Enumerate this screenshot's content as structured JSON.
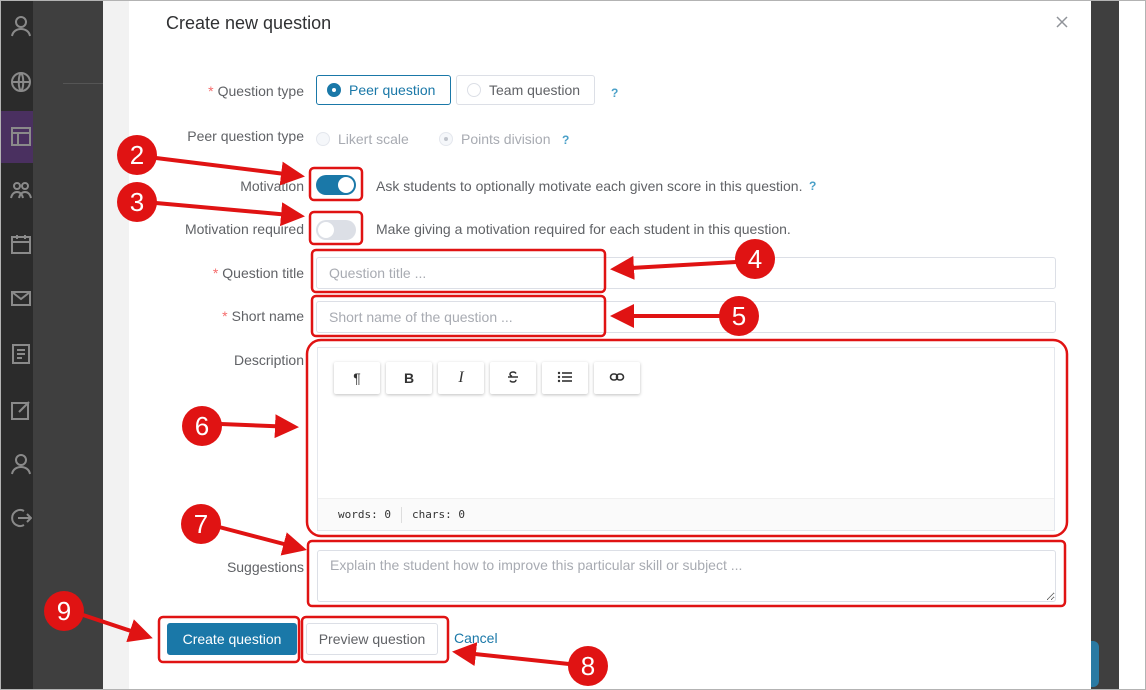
{
  "dialog": {
    "title": "Create new question"
  },
  "form": {
    "question_type": {
      "label": "Question type",
      "options": [
        "Peer question",
        "Team question"
      ],
      "selected": "Peer question"
    },
    "peer_question_type": {
      "label": "Peer question type",
      "options": [
        "Likert scale",
        "Points division"
      ],
      "selected": "Points division"
    },
    "motivation": {
      "label": "Motivation",
      "enabled": true,
      "description": "Ask students to optionally motivate each given score in this question."
    },
    "motivation_required": {
      "label": "Motivation required",
      "enabled": false,
      "description": "Make giving a motivation required for each student in this question."
    },
    "question_title": {
      "label": "Question title",
      "value": "",
      "placeholder": "Question title ..."
    },
    "short_name": {
      "label": "Short name",
      "value": "",
      "placeholder": "Short name of the question ..."
    },
    "description": {
      "label": "Description",
      "toolbar": [
        "paragraph-icon",
        "bold-icon",
        "italic-icon",
        "strikethrough-icon",
        "bullet-list-icon",
        "link-icon"
      ],
      "paragraph_glyph": "¶",
      "bold_glyph": "B",
      "italic_glyph": "I",
      "words_label": "words: 0",
      "chars_label": "chars: 0"
    },
    "suggestions": {
      "label": "Suggestions",
      "value": "",
      "placeholder": "Explain the student how to improve this particular skill or subject ..."
    }
  },
  "actions": {
    "create": "Create question",
    "preview": "Preview question",
    "cancel": "Cancel"
  },
  "help_glyph": "?",
  "annotations": [
    "2",
    "3",
    "4",
    "5",
    "6",
    "7",
    "8",
    "9"
  ],
  "colors": {
    "primary": "#1a78a8",
    "annotation": "#e01313",
    "required": "#f56c6c",
    "help": "#4aa0c8"
  }
}
